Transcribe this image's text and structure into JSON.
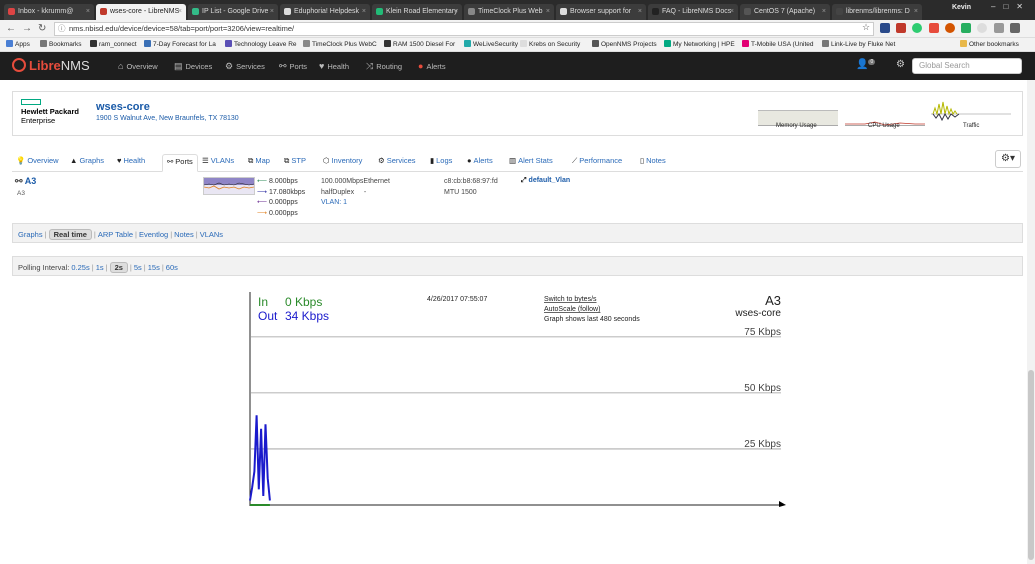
{
  "browser": {
    "tabs": [
      {
        "title": "Inbox - kkrumm@",
        "color": "#d44"
      },
      {
        "title": "wses-core - LibreNMS",
        "color": "#c0392b",
        "active": true
      },
      {
        "title": "IP List - Google Drive",
        "color": "#3b8"
      },
      {
        "title": "Eduphoria! Helpdesk",
        "color": "#ddd"
      },
      {
        "title": "Klein Road Elementary",
        "color": "#2b7"
      },
      {
        "title": "TimeClock Plus Web",
        "color": "#888"
      },
      {
        "title": "Browser support for",
        "color": "#ddd"
      },
      {
        "title": "FAQ - LibreNMS Docs",
        "color": "#222"
      },
      {
        "title": "CentOS 7 (Apache)",
        "color": "#555"
      },
      {
        "title": "librenms/librenms: D",
        "color": "#444"
      }
    ],
    "profile": "Kevin",
    "url": "nms.nbisd.edu/device/device=58/tab=port/port=3206/view=realtime/",
    "bookmarks": [
      {
        "label": "Apps",
        "color": "#4a7fd4"
      },
      {
        "label": "Bookmarks",
        "color": "#777"
      },
      {
        "label": "ram_connect",
        "color": "#333"
      },
      {
        "label": "7-Day Forecast for La",
        "color": "#3a6fb5"
      },
      {
        "label": "Technology Leave Re",
        "color": "#5a4fb5"
      },
      {
        "label": "TimeClock Plus WebC",
        "color": "#888"
      },
      {
        "label": "RAM 1500 Diesel For",
        "color": "#333"
      },
      {
        "label": "WeLiveSecurity",
        "color": "#2aa"
      },
      {
        "label": "Krebs on Security",
        "color": "#ddd"
      },
      {
        "label": "OpenNMS Projects",
        "color": "#555"
      },
      {
        "label": "My Networking | HPE",
        "color": "#01a982"
      },
      {
        "label": "T-Mobile USA (United",
        "color": "#e20074"
      },
      {
        "label": "Link-Live by Fluke Net",
        "color": "#777"
      },
      {
        "label": "Other bookmarks",
        "color": "#e8b84a"
      }
    ]
  },
  "navbar": {
    "brand_a": "Libre",
    "brand_b": "NMS",
    "items": [
      {
        "label": "Overview",
        "icon": "home-icon",
        "glyph": "⌂"
      },
      {
        "label": "Devices",
        "icon": "server-icon",
        "glyph": "▤"
      },
      {
        "label": "Services",
        "icon": "cogs-icon",
        "glyph": "⚙"
      },
      {
        "label": "Ports",
        "icon": "link-icon",
        "glyph": "⚯"
      },
      {
        "label": "Health",
        "icon": "heartbeat-icon",
        "glyph": "♥"
      },
      {
        "label": "Routing",
        "icon": "random-icon",
        "glyph": "⤨"
      },
      {
        "label": "Alerts",
        "icon": "alert-icon",
        "glyph": "●"
      }
    ],
    "notifications": "0",
    "search_placeholder": "Global Search"
  },
  "device": {
    "vendor_line1": "Hewlett Packard",
    "vendor_line2": "Enterprise",
    "name": "wses-core",
    "address": "1900 S Walnut Ave, New Braunfels, TX 78130",
    "mini_graphs": [
      "Memory Usage",
      "CPU Usage",
      "Traffic"
    ]
  },
  "device_tabs": [
    {
      "label": "Overview",
      "icon": "lightbulb-icon",
      "glyph": "💡"
    },
    {
      "label": "Graphs",
      "icon": "area-chart-icon",
      "glyph": "▲"
    },
    {
      "label": "Health",
      "icon": "heartbeat-icon",
      "glyph": "♥"
    },
    {
      "label": "Ports",
      "icon": "link-icon",
      "glyph": "⚯",
      "active": true
    },
    {
      "label": "VLANs",
      "icon": "tasks-icon",
      "glyph": "☰"
    },
    {
      "label": "Map",
      "icon": "sitemap-icon",
      "glyph": "⧉"
    },
    {
      "label": "STP",
      "icon": "sitemap-icon",
      "glyph": "⧉"
    },
    {
      "label": "Inventory",
      "icon": "cube-icon",
      "glyph": "⬡"
    },
    {
      "label": "Services",
      "icon": "cogs-icon",
      "glyph": "⚙"
    },
    {
      "label": "Logs",
      "icon": "book-icon",
      "glyph": "▮"
    },
    {
      "label": "Alerts",
      "icon": "exclamation-circle-icon",
      "glyph": "●"
    },
    {
      "label": "Alert Stats",
      "icon": "bar-chart-icon",
      "glyph": "▥"
    },
    {
      "label": "Performance",
      "icon": "line-chart-icon",
      "glyph": "⟋"
    },
    {
      "label": "Notes",
      "icon": "file-text-icon",
      "glyph": "▯"
    }
  ],
  "port": {
    "name": "A3",
    "description": "A3",
    "rate_in": "8.000bps",
    "rate_out": "17.080kbps",
    "pps_in": "0.000pps",
    "pps_out": "0.000pps",
    "speed": "100.000MbpsEthernet",
    "duplex": "halfDuplex",
    "dash": "-",
    "vlan": "VLAN: 1",
    "mac": "c8:cb:b8:68:97:fd",
    "mtu": "MTU 1500",
    "vlan_name": "default_Vlan"
  },
  "port_subnav": {
    "items": [
      "Graphs",
      "Real time",
      "ARP Table",
      "Eventlog",
      "Notes",
      "VLANs"
    ],
    "active": "Real time"
  },
  "polling": {
    "label": "Polling Interval:",
    "options": [
      "0.25s",
      "1s",
      "2s",
      "5s",
      "15s",
      "60s"
    ],
    "active": "2s"
  },
  "realtime": {
    "in_label": "In",
    "in_value": "0 Kbps",
    "out_label": "Out",
    "out_value": "34 Kbps",
    "timestamp": "4/26/2017 07:55:07",
    "switch_link": "Switch to bytes/s",
    "autoscale_link": "AutoScale (follow)",
    "duration_note": "Graph shows last 480 seconds",
    "port": "A3",
    "device": "wses-core",
    "gridlines": [
      "75 Kbps",
      "50 Kbps",
      "25 Kbps"
    ],
    "colors": {
      "in": "#2a8a2a",
      "out": "#1a1acc"
    }
  },
  "chart_data": {
    "type": "line",
    "x_unit": "seconds ago",
    "xlim": [
      480,
      0
    ],
    "ylim": [
      0,
      95
    ],
    "y_unit": "Kbps",
    "series": [
      {
        "name": "Out",
        "x": [
          480,
          478,
          476,
          474,
          472,
          470,
          468,
          466,
          464,
          462
        ],
        "values": [
          2,
          8,
          15,
          40,
          7,
          34,
          4,
          36,
          12,
          2
        ]
      },
      {
        "name": "In",
        "x": [
          480,
          478,
          476,
          474,
          472,
          470,
          468,
          466,
          464,
          462
        ],
        "values": [
          0,
          0,
          0,
          0,
          0,
          0,
          0,
          0,
          0,
          0
        ]
      }
    ]
  }
}
